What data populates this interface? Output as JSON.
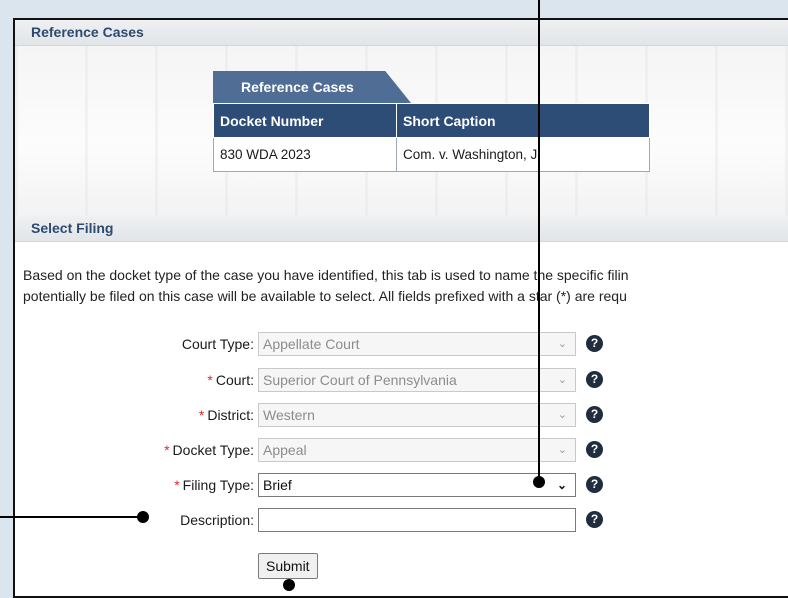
{
  "reference_section": {
    "header": "Reference Cases",
    "tab_label": "Reference Cases",
    "columns": [
      "Docket Number",
      "Short Caption"
    ],
    "rows": [
      [
        "830 WDA 2023",
        "Com. v. Washington, J."
      ]
    ]
  },
  "filing_section": {
    "header": "Select Filing",
    "description_line1": "Based on the docket type of the case you have identified, this tab is used to name the specific filin",
    "description_line2": "potentially be filed on this case will be available to select. All fields prefixed with a star (*) are requ"
  },
  "form": {
    "required_marker": "*",
    "help_glyph": "?",
    "dropdown_glyph": "⌄",
    "court_type": {
      "label": "Court Type:",
      "value": "Appellate Court"
    },
    "court": {
      "label": "Court:",
      "value": "Superior Court of Pennsylvania"
    },
    "district": {
      "label": "District:",
      "value": "Western"
    },
    "docket_type": {
      "label": "Docket Type:",
      "value": "Appeal"
    },
    "filing_type": {
      "label": "Filing Type:",
      "value": "Brief"
    },
    "description": {
      "label": "Description:",
      "value": ""
    },
    "submit_label": "Submit"
  },
  "colors": {
    "table_header": "#2e4d76",
    "tab": "#4f6d95",
    "section_header_text": "#2b4b70",
    "required_star": "#d82c2c",
    "callout": "#000000"
  }
}
